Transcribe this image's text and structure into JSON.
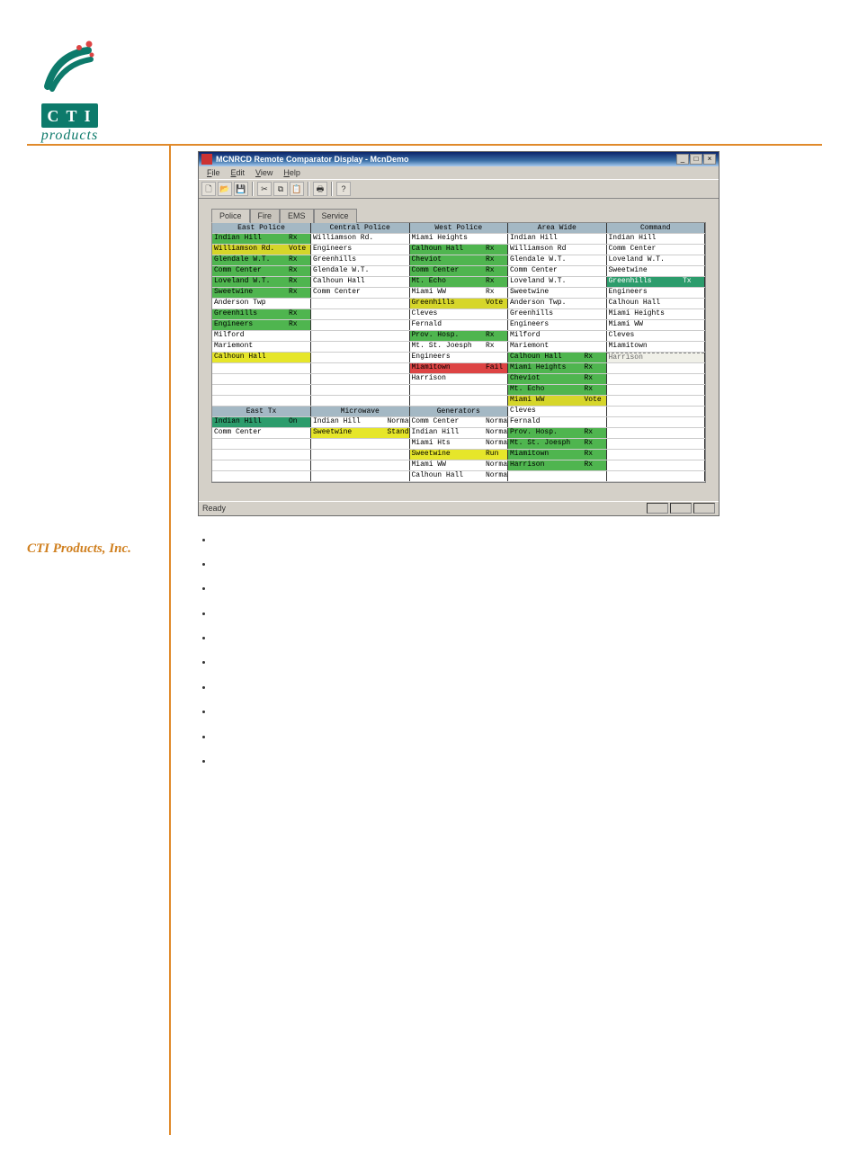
{
  "logo": {
    "brand_line1": "C T I",
    "brand_line2": "products"
  },
  "doc": {
    "company_name": "CTI Products, Inc."
  },
  "window": {
    "title": "MCNRCD Remote Comparator Display - McnDemo",
    "menus": [
      "File",
      "Edit",
      "View",
      "Help"
    ],
    "status": "Ready",
    "tabs": [
      "Police",
      "Fire",
      "EMS",
      "Service"
    ],
    "toolbar_icons": [
      "new-icon",
      "open-icon",
      "save-icon",
      "cut-icon",
      "copy-icon",
      "paste-icon",
      "print-icon",
      "help-icon"
    ]
  },
  "grid": {
    "section1_headers": [
      "East Police",
      "Central Police",
      "West Police",
      "Area Wide",
      "Command"
    ],
    "section2_headers": [
      "East Tx",
      "Microwave",
      "Generators",
      "",
      ""
    ],
    "section1_rows": [
      [
        {
          "n": "Indian Hill",
          "s": "Rx",
          "c": "rx"
        },
        {
          "n": "Williamson Rd.",
          "s": "",
          "c": "plain"
        },
        {
          "n": "Miami Heights",
          "s": "",
          "c": "plain"
        },
        {
          "n": "Indian Hill",
          "s": "",
          "c": "plain"
        },
        {
          "n": "Indian Hill",
          "s": "",
          "c": "plain"
        }
      ],
      [
        {
          "n": "Williamson Rd.",
          "s": "Vote",
          "c": "vote"
        },
        {
          "n": "Engineers",
          "s": "",
          "c": "plain"
        },
        {
          "n": "Calhoun Hall",
          "s": "Rx",
          "c": "rx"
        },
        {
          "n": "Williamson Rd",
          "s": "",
          "c": "plain"
        },
        {
          "n": "Comm Center",
          "s": "",
          "c": "plain"
        }
      ],
      [
        {
          "n": "Glendale W.T.",
          "s": "Rx",
          "c": "rx"
        },
        {
          "n": "Greenhills",
          "s": "",
          "c": "plain"
        },
        {
          "n": "Cheviot",
          "s": "Rx",
          "c": "rx"
        },
        {
          "n": "Glendale W.T.",
          "s": "",
          "c": "plain"
        },
        {
          "n": "Loveland W.T.",
          "s": "",
          "c": "plain"
        }
      ],
      [
        {
          "n": "Comm Center",
          "s": "Rx",
          "c": "rx"
        },
        {
          "n": "Glendale W.T.",
          "s": "",
          "c": "plain"
        },
        {
          "n": "Comm Center",
          "s": "Rx",
          "c": "rx"
        },
        {
          "n": "Comm Center",
          "s": "",
          "c": "plain"
        },
        {
          "n": "Sweetwine",
          "s": "",
          "c": "plain"
        }
      ],
      [
        {
          "n": "Loveland W.T.",
          "s": "Rx",
          "c": "rx"
        },
        {
          "n": "Calhoun Hall",
          "s": "",
          "c": "plain"
        },
        {
          "n": "Mt. Echo",
          "s": "Rx",
          "c": "rx"
        },
        {
          "n": "Loveland W.T.",
          "s": "",
          "c": "plain"
        },
        {
          "n": "Greenhills",
          "s": "Tx",
          "c": "tx"
        }
      ],
      [
        {
          "n": "Sweetwine",
          "s": "Rx",
          "c": "rx"
        },
        {
          "n": "Comm Center",
          "s": "",
          "c": "plain"
        },
        {
          "n": "Miami WW",
          "s": "Rx",
          "c": "plain"
        },
        {
          "n": "Sweetwine",
          "s": "",
          "c": "plain"
        },
        {
          "n": "Engineers",
          "s": "",
          "c": "plain"
        }
      ],
      [
        {
          "n": "Anderson Twp",
          "s": "",
          "c": "plain"
        },
        {
          "n": "",
          "s": "",
          "c": "plain"
        },
        {
          "n": "Greenhills",
          "s": "Vote",
          "c": "vote"
        },
        {
          "n": "Anderson Twp.",
          "s": "",
          "c": "plain"
        },
        {
          "n": "Calhoun Hall",
          "s": "",
          "c": "plain"
        }
      ],
      [
        {
          "n": "Greenhills",
          "s": "Rx",
          "c": "rx"
        },
        {
          "n": "",
          "s": "",
          "c": "plain"
        },
        {
          "n": "Cleves",
          "s": "",
          "c": "plain"
        },
        {
          "n": "Greenhills",
          "s": "",
          "c": "plain"
        },
        {
          "n": "Miami Heights",
          "s": "",
          "c": "plain"
        }
      ],
      [
        {
          "n": "Engineers",
          "s": "Rx",
          "c": "rx"
        },
        {
          "n": "",
          "s": "",
          "c": "plain"
        },
        {
          "n": "Fernald",
          "s": "",
          "c": "plain"
        },
        {
          "n": "Engineers",
          "s": "",
          "c": "plain"
        },
        {
          "n": "Miami WW",
          "s": "",
          "c": "plain"
        }
      ],
      [
        {
          "n": "Milford",
          "s": "",
          "c": "plain"
        },
        {
          "n": "",
          "s": "",
          "c": "plain"
        },
        {
          "n": "Prov. Hosp.",
          "s": "Rx",
          "c": "rx"
        },
        {
          "n": "Milford",
          "s": "",
          "c": "plain"
        },
        {
          "n": "Cleves",
          "s": "",
          "c": "plain"
        }
      ],
      [
        {
          "n": "Mariemont",
          "s": "",
          "c": "plain"
        },
        {
          "n": "",
          "s": "",
          "c": "plain"
        },
        {
          "n": "Mt. St. Joesph",
          "s": "Rx",
          "c": "plain"
        },
        {
          "n": "Mariemont",
          "s": "",
          "c": "plain"
        },
        {
          "n": "Miamitown",
          "s": "",
          "c": "plain"
        }
      ],
      [
        {
          "n": "Calhoun Hall",
          "s": "",
          "c": "sel"
        },
        {
          "n": "",
          "s": "",
          "c": "plain"
        },
        {
          "n": "Engineers",
          "s": "",
          "c": "plain"
        },
        {
          "n": "Calhoun Hall",
          "s": "Rx",
          "c": "rx"
        },
        {
          "n": "Harrison",
          "s": "",
          "c": "dash"
        }
      ],
      [
        {
          "n": "",
          "s": "",
          "c": "plain"
        },
        {
          "n": "",
          "s": "",
          "c": "plain"
        },
        {
          "n": "Miamitown",
          "s": "Fail",
          "c": "fail"
        },
        {
          "n": "Miami Heights",
          "s": "Rx",
          "c": "rx"
        },
        {
          "n": "",
          "s": "",
          "c": "plain"
        }
      ],
      [
        {
          "n": "",
          "s": "",
          "c": "plain"
        },
        {
          "n": "",
          "s": "",
          "c": "plain"
        },
        {
          "n": "Harrison",
          "s": "",
          "c": "plain"
        },
        {
          "n": "Cheviot",
          "s": "Rx",
          "c": "rx"
        },
        {
          "n": "",
          "s": "",
          "c": "plain"
        }
      ],
      [
        {
          "n": "",
          "s": "",
          "c": "plain"
        },
        {
          "n": "",
          "s": "",
          "c": "plain"
        },
        {
          "n": "",
          "s": "",
          "c": "plain"
        },
        {
          "n": "Mt. Echo",
          "s": "Rx",
          "c": "rx"
        },
        {
          "n": "",
          "s": "",
          "c": "plain"
        }
      ],
      [
        {
          "n": "",
          "s": "",
          "c": "plain"
        },
        {
          "n": "",
          "s": "",
          "c": "plain"
        },
        {
          "n": "",
          "s": "",
          "c": "plain"
        },
        {
          "n": "Miami WW",
          "s": "Vote",
          "c": "vote"
        },
        {
          "n": "",
          "s": "",
          "c": "plain"
        }
      ]
    ],
    "section2_rows": [
      [
        {
          "n": "Indian Hill",
          "s": "On",
          "c": "on"
        },
        {
          "n": "Indian Hill",
          "s": "Normal",
          "c": "plain"
        },
        {
          "n": "Comm Center",
          "s": "Normal",
          "c": "plain"
        },
        {
          "n": "Fernald",
          "s": "",
          "c": "plain"
        },
        {
          "n": "",
          "s": "",
          "c": "plain"
        }
      ],
      [
        {
          "n": "Comm Center",
          "s": "",
          "c": "plain"
        },
        {
          "n": "Sweetwine",
          "s": "Standby",
          "c": "standby"
        },
        {
          "n": "Indian Hill",
          "s": "Normal",
          "c": "plain"
        },
        {
          "n": "Prov. Hosp.",
          "s": "Rx",
          "c": "rx"
        },
        {
          "n": "",
          "s": "",
          "c": "plain"
        }
      ],
      [
        {
          "n": "",
          "s": "",
          "c": "plain"
        },
        {
          "n": "",
          "s": "",
          "c": "plain"
        },
        {
          "n": "Miami Hts",
          "s": "Normal",
          "c": "plain"
        },
        {
          "n": "Mt. St. Joesph",
          "s": "Rx",
          "c": "rx"
        },
        {
          "n": "",
          "s": "",
          "c": "plain"
        }
      ],
      [
        {
          "n": "",
          "s": "",
          "c": "plain"
        },
        {
          "n": "",
          "s": "",
          "c": "plain"
        },
        {
          "n": "Sweetwine",
          "s": "Run",
          "c": "run"
        },
        {
          "n": "Miamitown",
          "s": "Rx",
          "c": "rx"
        },
        {
          "n": "",
          "s": "",
          "c": "plain"
        }
      ],
      [
        {
          "n": "",
          "s": "",
          "c": "plain"
        },
        {
          "n": "",
          "s": "",
          "c": "plain"
        },
        {
          "n": "Miami WW",
          "s": "Normal",
          "c": "plain"
        },
        {
          "n": "Harrison",
          "s": "Rx",
          "c": "rx"
        },
        {
          "n": "",
          "s": "",
          "c": "plain"
        }
      ],
      [
        {
          "n": "",
          "s": "",
          "c": "plain"
        },
        {
          "n": "",
          "s": "",
          "c": "plain"
        },
        {
          "n": "Calhoun Hall",
          "s": "Normal",
          "c": "plain"
        },
        {
          "n": "",
          "s": "",
          "c": "plain"
        },
        {
          "n": "",
          "s": "",
          "c": "plain"
        }
      ]
    ],
    "area_wide_extra": [
      {
        "n": "Cleves",
        "s": "",
        "c": "plain"
      }
    ]
  }
}
